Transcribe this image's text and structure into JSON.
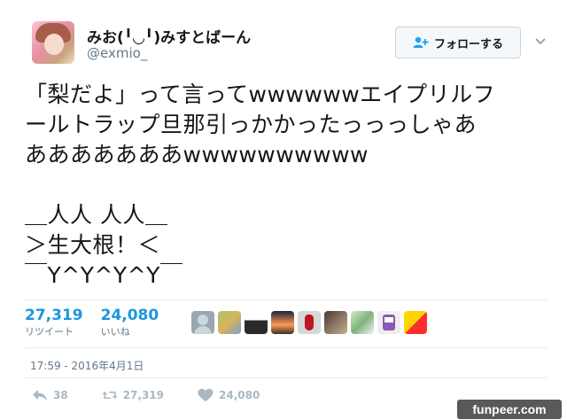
{
  "user": {
    "display_name": "みお(╹◡╹)みすとばーん",
    "screen_name": "@exmio_"
  },
  "header": {
    "follow_label": "フォローする"
  },
  "tweet": {
    "lines": [
      "「梨だよ」って言ってwwwwwwエイプリルフ",
      "ールトラップ旦那引っかかったっっっしゃあ",
      "あああああああwwwwwwwwww",
      "",
      "＿人人 人人＿",
      "＞生大根！＜",
      "￣Y^Y^Y^Y￣"
    ]
  },
  "stats": {
    "retweets": {
      "count": "27,319",
      "label": "リツイート"
    },
    "likes": {
      "count": "24,080",
      "label": "いいね"
    }
  },
  "likers_count_shown": 9,
  "timestamp": "17:59 - 2016年4月1日",
  "actions": {
    "reply_count": "38",
    "retweet_count": "27,319",
    "like_count": "24,080"
  },
  "watermark": "funpeer.com",
  "colors": {
    "accent": "#1b95e0",
    "muted": "#657786",
    "icon": "#aab8c2"
  },
  "icons": {
    "follow": "add-user-icon",
    "caret": "chevron-down-icon",
    "reply": "reply-icon",
    "retweet": "retweet-icon",
    "like": "heart-icon"
  }
}
